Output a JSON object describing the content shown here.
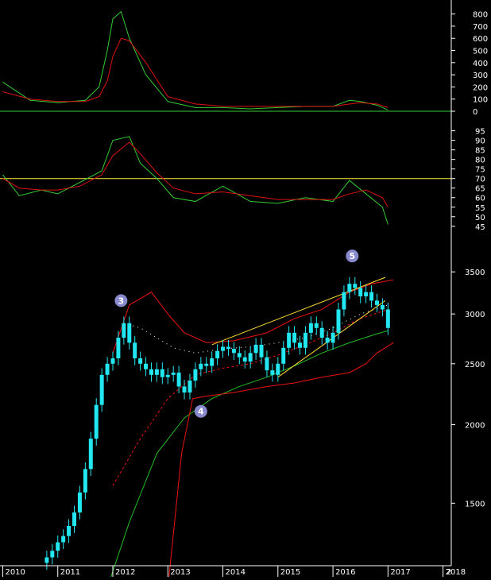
{
  "colors": {
    "background": "#000000",
    "axis": "#ffffff",
    "text": "#ffffff",
    "indicator_fast": "#33cc33",
    "indicator_slow": "#dd1111",
    "ref_line": "#ffee33",
    "candle": "#22e6f0",
    "sma_long": "#22bb22",
    "band": "#ee1111",
    "trend": "#ffdd33",
    "marker": "#8888cc",
    "divider": "#33cc33"
  },
  "chart_data": [
    {
      "type": "line",
      "panel": "top",
      "yticks": [
        800,
        700,
        600,
        500,
        400,
        300,
        200,
        100,
        0
      ],
      "ylim": [
        0,
        850
      ],
      "reference_line": 0,
      "x": [
        "2010.0",
        "2010.5",
        "2011.0",
        "2011.5",
        "2011.75",
        "2011.9",
        "2012.0",
        "2012.15",
        "2012.3",
        "2012.6",
        "2013.0",
        "2013.5",
        "2014.0",
        "2014.5",
        "2015.0",
        "2015.5",
        "2016.0",
        "2016.3",
        "2016.5",
        "2016.8",
        "2017.0"
      ],
      "series": [
        {
          "key": "fast",
          "values": [
            240,
            90,
            70,
            90,
            200,
            500,
            760,
            820,
            600,
            300,
            80,
            30,
            30,
            20,
            30,
            40,
            40,
            90,
            80,
            50,
            10
          ]
        },
        {
          "key": "slow",
          "values": [
            160,
            100,
            80,
            80,
            120,
            250,
            450,
            600,
            580,
            400,
            120,
            60,
            40,
            40,
            40,
            40,
            40,
            60,
            70,
            60,
            30
          ]
        }
      ]
    },
    {
      "type": "line",
      "panel": "middle",
      "yticks": [
        95,
        90,
        85,
        80,
        75,
        70,
        65,
        60,
        55,
        50,
        45
      ],
      "ylim": [
        42,
        99
      ],
      "reference_line": 70,
      "x": [
        "2010.0",
        "2010.3",
        "2010.7",
        "2011.0",
        "2011.4",
        "2011.8",
        "2012.0",
        "2012.3",
        "2012.5",
        "2012.8",
        "2013.1",
        "2013.5",
        "2014.0",
        "2014.5",
        "2015.0",
        "2015.5",
        "2016.0",
        "2016.3",
        "2016.6",
        "2016.9",
        "2017.0"
      ],
      "series": [
        {
          "key": "fast",
          "values": [
            72,
            61,
            64,
            62,
            68,
            74,
            90,
            92,
            78,
            70,
            60,
            58,
            66,
            58,
            57,
            60,
            58,
            69,
            62,
            55,
            46
          ]
        },
        {
          "key": "slow",
          "values": [
            70,
            65,
            64,
            64,
            66,
            72,
            82,
            89,
            83,
            73,
            65,
            62,
            63,
            61,
            59,
            59,
            59,
            62,
            64,
            60,
            55
          ]
        }
      ]
    },
    {
      "type": "candlestick",
      "panel": "main",
      "yscale": "log",
      "yticks": [
        3500,
        3000,
        2500,
        2000,
        1500
      ],
      "ylim": [
        1200,
        3900
      ],
      "xticks": [
        "2010",
        "2011",
        "2012",
        "2013",
        "2014",
        "2015",
        "2016",
        "2017",
        "2018",
        "2"
      ],
      "xlim": [
        2009.95,
        2018.15
      ],
      "annotations": [
        {
          "label": "3",
          "x": 2012.15,
          "y": 3150
        },
        {
          "label": "4",
          "x": 2013.6,
          "y": 2100
        },
        {
          "label": "5",
          "x": 2016.35,
          "y": 3710
        }
      ],
      "closes": [
        [
          2010.8,
          1230
        ],
        [
          2010.9,
          1260
        ],
        [
          2011.0,
          1300
        ],
        [
          2011.1,
          1330
        ],
        [
          2011.2,
          1380
        ],
        [
          2011.3,
          1450
        ],
        [
          2011.4,
          1560
        ],
        [
          2011.5,
          1700
        ],
        [
          2011.6,
          1900
        ],
        [
          2011.7,
          2150
        ],
        [
          2011.8,
          2400
        ],
        [
          2011.9,
          2500
        ],
        [
          2012.0,
          2550
        ],
        [
          2012.1,
          2750
        ],
        [
          2012.2,
          2900
        ],
        [
          2012.3,
          2700
        ],
        [
          2012.4,
          2550
        ],
        [
          2012.5,
          2500
        ],
        [
          2012.6,
          2450
        ],
        [
          2012.7,
          2400
        ],
        [
          2012.8,
          2450
        ],
        [
          2012.9,
          2380
        ],
        [
          2013.0,
          2400
        ],
        [
          2013.1,
          2420
        ],
        [
          2013.2,
          2300
        ],
        [
          2013.3,
          2250
        ],
        [
          2013.4,
          2350
        ],
        [
          2013.5,
          2450
        ],
        [
          2013.6,
          2500
        ],
        [
          2013.7,
          2480
        ],
        [
          2013.8,
          2550
        ],
        [
          2013.9,
          2620
        ],
        [
          2014.0,
          2660
        ],
        [
          2014.1,
          2640
        ],
        [
          2014.2,
          2600
        ],
        [
          2014.3,
          2560
        ],
        [
          2014.4,
          2520
        ],
        [
          2014.5,
          2600
        ],
        [
          2014.6,
          2680
        ],
        [
          2014.7,
          2560
        ],
        [
          2014.8,
          2440
        ],
        [
          2014.9,
          2400
        ],
        [
          2015.0,
          2500
        ],
        [
          2015.1,
          2650
        ],
        [
          2015.2,
          2800
        ],
        [
          2015.3,
          2700
        ],
        [
          2015.4,
          2650
        ],
        [
          2015.5,
          2800
        ],
        [
          2015.6,
          2900
        ],
        [
          2015.7,
          2850
        ],
        [
          2015.8,
          2750
        ],
        [
          2015.9,
          2700
        ],
        [
          2016.0,
          2800
        ],
        [
          2016.1,
          3050
        ],
        [
          2016.2,
          3250
        ],
        [
          2016.3,
          3350
        ],
        [
          2016.4,
          3300
        ],
        [
          2016.5,
          3200
        ],
        [
          2016.6,
          3250
        ],
        [
          2016.7,
          3150
        ],
        [
          2016.8,
          3100
        ],
        [
          2016.9,
          3050
        ],
        [
          2017.0,
          2850
        ]
      ],
      "lines": [
        {
          "key": "sma_long",
          "points": [
            [
              2011.9,
              1100
            ],
            [
              2012.3,
              1400
            ],
            [
              2012.8,
              1800
            ],
            [
              2013.3,
              2050
            ],
            [
              2013.8,
              2200
            ],
            [
              2014.3,
              2300
            ],
            [
              2014.8,
              2380
            ],
            [
              2015.3,
              2480
            ],
            [
              2015.8,
              2600
            ],
            [
              2016.3,
              2700
            ],
            [
              2016.8,
              2790
            ],
            [
              2017.0,
              2820
            ]
          ]
        },
        {
          "key": "sma_mid",
          "points": [
            [
              2012.0,
              1600
            ],
            [
              2012.5,
              1900
            ],
            [
              2013.0,
              2200
            ],
            [
              2013.5,
              2400
            ],
            [
              2014.0,
              2460
            ],
            [
              2014.5,
              2500
            ],
            [
              2015.0,
              2580
            ],
            [
              2015.5,
              2680
            ],
            [
              2016.0,
              2800
            ],
            [
              2016.5,
              2950
            ],
            [
              2017.0,
              3050
            ]
          ]
        },
        {
          "key": "band_upper",
          "points": [
            [
              2012.0,
              2600
            ],
            [
              2012.3,
              3100
            ],
            [
              2012.7,
              3250
            ],
            [
              2013.0,
              3000
            ],
            [
              2013.3,
              2800
            ],
            [
              2013.7,
              2700
            ],
            [
              2014.2,
              2720
            ],
            [
              2014.8,
              2800
            ],
            [
              2015.3,
              2950
            ],
            [
              2015.8,
              3050
            ],
            [
              2016.3,
              3250
            ],
            [
              2016.7,
              3350
            ],
            [
              2017.1,
              3400
            ]
          ]
        },
        {
          "key": "band_lower",
          "points": [
            [
              2013.0,
              1100
            ],
            [
              2013.25,
              1800
            ],
            [
              2013.45,
              2200
            ],
            [
              2013.7,
              2220
            ],
            [
              2014.2,
              2250
            ],
            [
              2014.8,
              2300
            ],
            [
              2015.3,
              2330
            ],
            [
              2015.8,
              2380
            ],
            [
              2016.3,
              2420
            ],
            [
              2016.6,
              2500
            ],
            [
              2016.8,
              2600
            ],
            [
              2017.1,
              2700
            ]
          ]
        },
        {
          "key": "band_mid",
          "points": [
            [
              2012.2,
              2900
            ],
            [
              2012.5,
              2850
            ],
            [
              2012.8,
              2750
            ],
            [
              2013.1,
              2650
            ],
            [
              2013.5,
              2600
            ],
            [
              2014.0,
              2640
            ],
            [
              2014.5,
              2660
            ],
            [
              2015.0,
              2700
            ],
            [
              2015.5,
              2750
            ],
            [
              2016.0,
              2850
            ],
            [
              2016.5,
              3000
            ],
            [
              2017.0,
              3100
            ]
          ]
        }
      ],
      "trend_lines": [
        {
          "from": [
            2013.8,
            2680
          ],
          "to": [
            2016.95,
            3430
          ]
        },
        {
          "from": [
            2015.0,
            2380
          ],
          "to": [
            2016.95,
            3150
          ]
        }
      ]
    }
  ]
}
